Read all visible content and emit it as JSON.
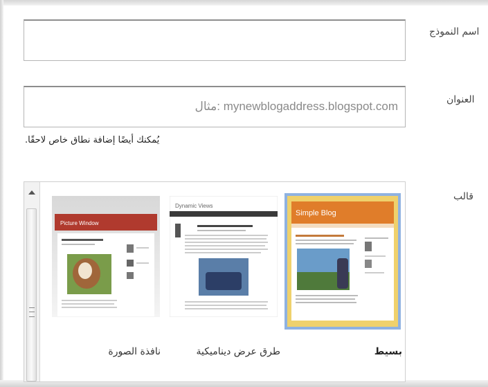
{
  "form": {
    "name_label": "اسم النموذج",
    "name_value": "",
    "address_label": "العنوان",
    "address_placeholder": "مثال: mynewblogaddress.blogspot.com",
    "hint": "يُمكنك أيضًا إضافة نطاق خاص لاحقًا.",
    "template_label": "قالب"
  },
  "templates": [
    {
      "name": "بسيط",
      "preview_title": "Simple Blog",
      "selected": true
    },
    {
      "name": "طرق عرض ديناميكية",
      "preview_title": "Dynamic Views",
      "selected": false
    },
    {
      "name": "نافذة الصورة",
      "preview_title": "Picture Window",
      "selected": false
    }
  ],
  "colors": {
    "selected_border": "#8fb2e1",
    "simple_header": "#e07d2a",
    "picture_header": "#b03a2e"
  }
}
